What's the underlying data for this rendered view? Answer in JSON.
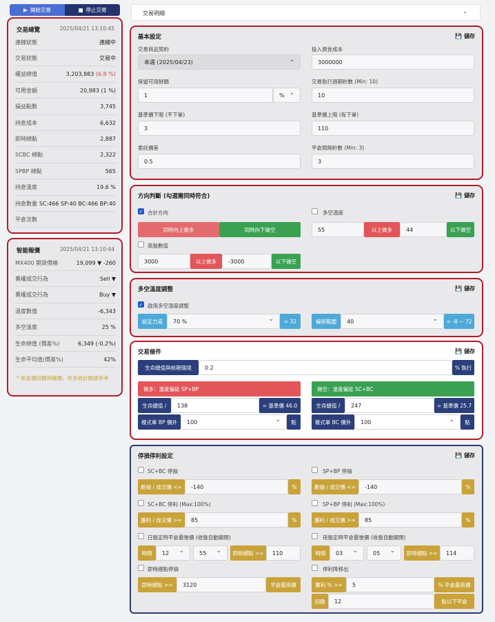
{
  "topbar": {
    "start": "開始交易",
    "stop": "停止交易"
  },
  "overview": {
    "title": "交易總覽",
    "time": "2025/04/21 13:10:45",
    "rows": [
      [
        "連線狀態",
        "連線中"
      ],
      [
        "交易狀態",
        "交易中"
      ],
      [
        "權益總值",
        "3,203,883",
        "(6.8 %)"
      ],
      [
        "可用金額",
        "20,983 (1 %)"
      ],
      [
        "損益點數",
        "3,745"
      ],
      [
        "持倉成本",
        "6,632"
      ],
      [
        "即時總點",
        "2,887"
      ],
      [
        "SCBC 總點",
        "2,322"
      ],
      [
        "SPBP 總點",
        "565"
      ],
      [
        "持倉溫度",
        "19.6 %"
      ],
      [
        "持倉數量",
        "SC:466 SP:40 BC:466 BP:40"
      ],
      [
        "平倉次數",
        ""
      ]
    ]
  },
  "smart": {
    "title": "智能報價",
    "time": "2025/04/21 13:10:44",
    "rows": [
      [
        "MX400 期貨價格",
        "19,099 ▼ -260"
      ],
      [
        "賣權成交行為",
        "Sell ▼"
      ],
      [
        "賣權成交行為",
        "Buy ▼"
      ],
      [
        "溫度數值",
        "-6,343"
      ],
      [
        "多空溫度",
        "25 %"
      ],
      [
        "生命總值 (價差%)",
        "6,349 (-0.2%)"
      ],
      [
        "生命平均值(價差%)",
        "42%"
      ]
    ],
    "note": "* 新倉價回饋商機價，但多統計數據參考"
  },
  "dropdown": {
    "label": "交易明細"
  },
  "basic": {
    "title": "基本設定",
    "save": "儲存",
    "contract_label": "交易商品契約",
    "contract": "本週 (2025/04/23)",
    "capital_label": "投入資金成本",
    "capital": "3000000",
    "reserve_label": "保留可用餘額",
    "reserve": "1",
    "reserve_unit": "%",
    "interval_label": "交易執行週期秒數 (Min: 10)",
    "interval": "10",
    "low_label": "基準價下限 (不下單)",
    "low": "3",
    "high_label": "基準價上限 (有下單)",
    "high": "110",
    "delegate_label": "委託價差",
    "delegate": "0.5",
    "close_label": "平倉間隔秒數 (Min: 3)",
    "close": "3"
  },
  "direction": {
    "title": "方向判斷 (勾選需同時符合)",
    "save": "儲存",
    "c1": "合計方向",
    "c2": "多空溫度",
    "c3": "高盤數值",
    "b_up": "同時向上做多",
    "b_down": "同時向下做空",
    "v1": "55",
    "above": "以上做多",
    "v2": "44",
    "below": "以下做空",
    "v3": "3000",
    "v4": "-3000"
  },
  "temp": {
    "title": "多空溫度調整",
    "save": "儲存",
    "check": "啟用多空溫度調整",
    "l1": "設定力道",
    "v1": "70 %",
    "r1": "= 32",
    "l2": "偏移範圍",
    "v2": "40",
    "r2": "= -8 ~ 72"
  },
  "cond": {
    "title": "交易條件",
    "save": "儲存",
    "label": "生命總值與前期環境",
    "value": "0.2",
    "exec": "% 執行",
    "long_title": "做多：溫度偏延 SP+BP",
    "short_title": "做空：溫度偏延 SC+BC",
    "life": "生命總值 /",
    "lv": "138",
    "lb": "= 基準價 46.0",
    "sv": "247",
    "sb": "= 基準價 25.7",
    "bp": "複式單 BP 價外",
    "bpv": "100",
    "bc": "複式單 BC 價外",
    "bcv": "100",
    "pt": "點"
  },
  "stop": {
    "title": "停損停利設定",
    "save": "儲存",
    "a1": "SC+BC 停損",
    "a2": "SP+BP 停損",
    "loss": "虧損 / 成交價 <=",
    "lv": "-140",
    "pct": "%",
    "b1": "SC+BC 停利 (Max:100%)",
    "b2": "SP+BP 停利 (Max:100%)",
    "profit": "獲利 / 成交價 >=",
    "pv": "85",
    "c1": "日盤定時平倉最後價 (收盤自動關閉)",
    "c2": "夜盤定時平倉最後價 (收盤自動關閉)",
    "time": "時間",
    "h1": "12",
    "m1": "55",
    "inst": "即時總點 >=",
    "iv1": "110",
    "h2": "03",
    "m2": "05",
    "iv2": "114",
    "d1": "即時總點停損",
    "d2": "停利降移出",
    "dv1": "3120",
    "close": "平倉最高價",
    "profit2": "獲利 % >=",
    "pv2": "5",
    "hi": "% 平倉最高價",
    "retr": "回撤",
    "rv": "12",
    "low": "點以下平倉"
  }
}
